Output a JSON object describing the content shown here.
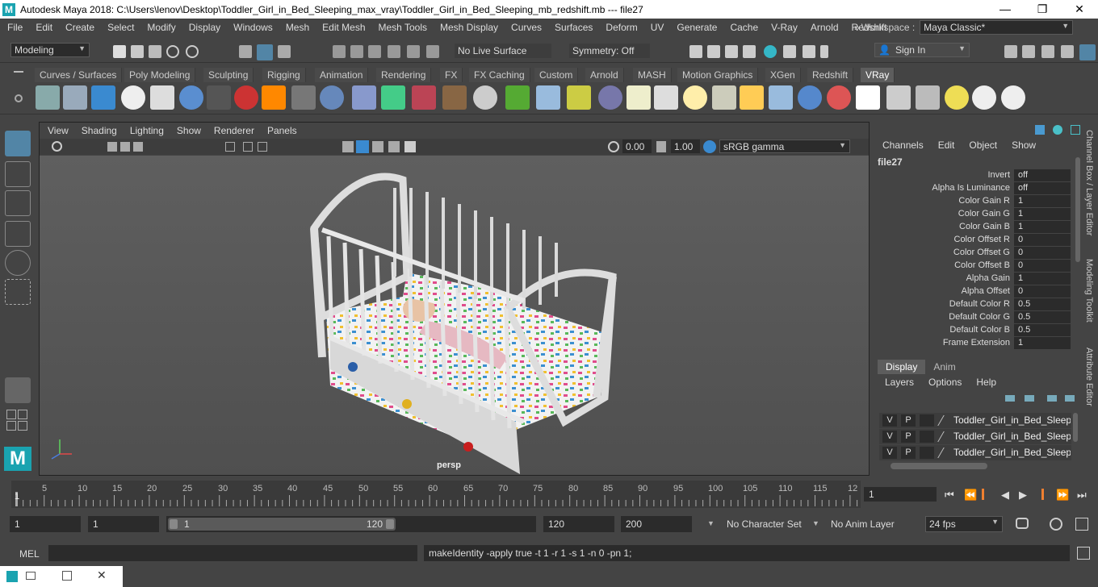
{
  "window": {
    "title": "Autodesk Maya 2018: C:\\Users\\lenov\\Desktop\\Toddler_Girl_in_Bed_Sleeping_max_vray\\Toddler_Girl_in_Bed_Sleeping_mb_redshift.mb   ---   file27",
    "minimize": "—",
    "maximize": "❐",
    "close": "✕"
  },
  "menu": [
    "File",
    "Edit",
    "Create",
    "Select",
    "Modify",
    "Display",
    "Windows",
    "Mesh",
    "Edit Mesh",
    "Mesh Tools",
    "Mesh Display",
    "Curves",
    "Surfaces",
    "Deform",
    "UV",
    "Generate",
    "Cache",
    "V-Ray",
    "Arnold",
    "Redshift"
  ],
  "workspace": {
    "label": "Workspace :",
    "value": "Maya Classic*",
    "more": "»"
  },
  "status": {
    "mode": "Modeling",
    "live_surface": "No Live Surface",
    "symmetry": "Symmetry: Off",
    "sign_in": "Sign In"
  },
  "shelf_tabs": [
    "Curves / Surfaces",
    "Poly Modeling",
    "Sculpting",
    "Rigging",
    "Animation",
    "Rendering",
    "FX",
    "FX Caching",
    "Custom",
    "Arnold",
    "MASH",
    "Motion Graphics",
    "XGen",
    "Redshift",
    "VRay"
  ],
  "active_shelf_tab": "VRay",
  "viewport": {
    "menu": [
      "View",
      "Shading",
      "Lighting",
      "Show",
      "Renderer",
      "Panels"
    ],
    "exposure": "0.00",
    "gamma": "1.00",
    "color_space": "sRGB gamma",
    "camera": "persp"
  },
  "channel_box": {
    "menu": [
      "Channels",
      "Edit",
      "Object",
      "Show"
    ],
    "node": "file27",
    "attributes": [
      {
        "name": "Invert",
        "value": "off"
      },
      {
        "name": "Alpha Is Luminance",
        "value": "off"
      },
      {
        "name": "Color Gain R",
        "value": "1"
      },
      {
        "name": "Color Gain G",
        "value": "1"
      },
      {
        "name": "Color Gain B",
        "value": "1"
      },
      {
        "name": "Color Offset R",
        "value": "0"
      },
      {
        "name": "Color Offset G",
        "value": "0"
      },
      {
        "name": "Color Offset B",
        "value": "0"
      },
      {
        "name": "Alpha Gain",
        "value": "1"
      },
      {
        "name": "Alpha Offset",
        "value": "0"
      },
      {
        "name": "Default Color R",
        "value": "0.5"
      },
      {
        "name": "Default Color G",
        "value": "0.5"
      },
      {
        "name": "Default Color B",
        "value": "0.5"
      },
      {
        "name": "Frame Extension",
        "value": "1"
      }
    ]
  },
  "side_tabs": [
    "Channel Box / Layer Editor",
    "Modeling Toolkit",
    "Attribute Editor"
  ],
  "layer_editor": {
    "tabs": [
      "Display",
      "Anim"
    ],
    "menu": [
      "Layers",
      "Options",
      "Help"
    ],
    "layers": [
      {
        "v": "V",
        "p": "P",
        "name": "Toddler_Girl_in_Bed_Sleeping"
      },
      {
        "v": "V",
        "p": "P",
        "name": "Toddler_Girl_in_Bed_Sleeping"
      },
      {
        "v": "V",
        "p": "P",
        "name": "Toddler_Girl_in_Bed_Sleeping"
      }
    ]
  },
  "timeline": {
    "ticks": [
      "1",
      "5",
      "10",
      "15",
      "20",
      "25",
      "30",
      "35",
      "40",
      "45",
      "50",
      "55",
      "60",
      "65",
      "70",
      "75",
      "80",
      "85",
      "90",
      "95",
      "100",
      "105",
      "110",
      "115",
      "12"
    ],
    "current_frame": "1"
  },
  "range": {
    "start": "1",
    "playback_start": "1",
    "slider_start": "1",
    "slider_end": "120",
    "playback_end": "120",
    "end": "200",
    "character_set": "No Character Set",
    "anim_layer": "No Anim Layer",
    "fps": "24 fps"
  },
  "command": {
    "lang": "MEL",
    "result": "makeIdentity -apply true -t 1 -r 1 -s 1 -n 0 -pn 1;"
  }
}
